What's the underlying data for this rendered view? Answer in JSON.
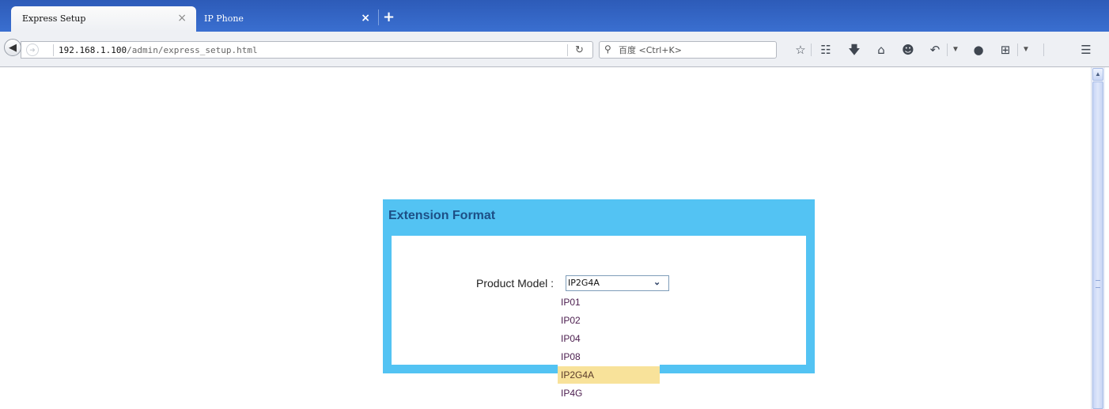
{
  "browser": {
    "tabs": [
      {
        "title": "Express Setup",
        "active": true
      },
      {
        "title": "IP Phone",
        "active": false
      }
    ],
    "tab_close_glyph": "×",
    "new_tab_glyph": "+",
    "url_host": "192.168.1.100",
    "url_path": "/admin/express_setup.html",
    "search_placeholder": "百度 <Ctrl+K>",
    "toolbar_icons": [
      "bookmark-star-icon",
      "reading-list-icon",
      "download-icon",
      "home-icon",
      "hello-chat-icon",
      "share-icon",
      "pocket-icon",
      "crop-screenshot-icon",
      "menu-icon"
    ]
  },
  "page": {
    "panel_title": "Extension Format",
    "product_model_label": "Product Model :",
    "product_model_value": "IP2G4A",
    "product_model_options": [
      "IP01",
      "IP02",
      "IP04",
      "IP08",
      "IP2G4A",
      "IP4G"
    ],
    "selected_option_index": 4
  },
  "colors": {
    "tab_strip": "#3a6fd0",
    "panel_border": "#53c3f3",
    "panel_title": "#1d4f86",
    "option_highlight": "#f8e29a"
  }
}
